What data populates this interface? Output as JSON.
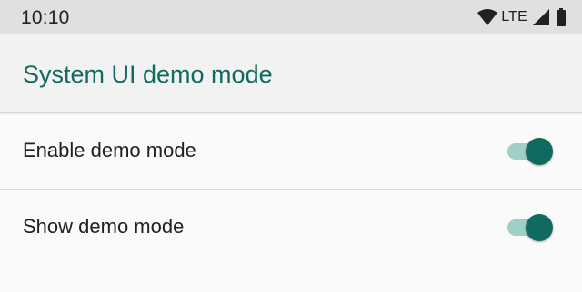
{
  "status_bar": {
    "time": "10:10",
    "network_label": "LTE",
    "icons": [
      "wifi-icon",
      "signal-icon",
      "battery-icon"
    ]
  },
  "app_bar": {
    "title": "System UI demo mode"
  },
  "settings": [
    {
      "label": "Enable demo mode",
      "enabled": true
    },
    {
      "label": "Show demo mode",
      "enabled": true
    }
  ],
  "colors": {
    "accent": "#0f6b5f",
    "toggle_track_on": "#9fcfc6",
    "status_bar_bg": "#e0e0e0",
    "app_bar_bg": "#f2f2f2",
    "background": "#fafafa"
  }
}
